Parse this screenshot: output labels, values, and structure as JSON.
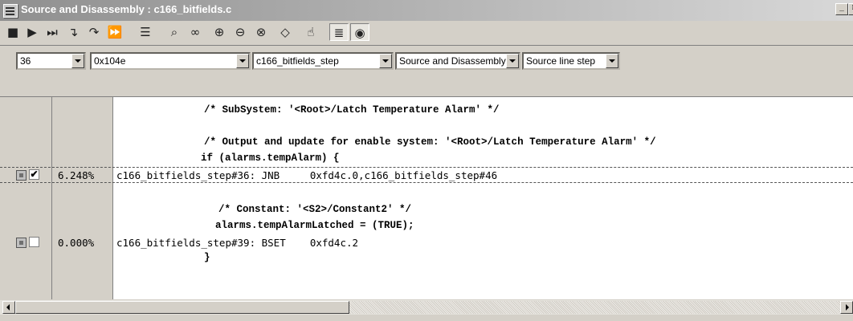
{
  "window": {
    "title": "Source and Disassembly : c166_bitfields.c",
    "min_glyph": "_",
    "max_glyph": "□"
  },
  "toolbar": {
    "tools": [
      {
        "name": "stop-icon",
        "glyph": "■"
      },
      {
        "name": "run-icon",
        "glyph": "▶"
      },
      {
        "name": "skip-to-end-icon",
        "glyph": "⏭"
      },
      {
        "name": "step-into-icon",
        "glyph": "↴"
      },
      {
        "name": "step-over-icon",
        "glyph": "↷"
      },
      {
        "name": "step-out-icon",
        "glyph": "⏩"
      },
      {
        "name": "align-icon",
        "glyph": "☰"
      },
      {
        "name": "find-icon",
        "glyph": "⌕"
      },
      {
        "name": "find-next-icon",
        "glyph": "∞"
      },
      {
        "name": "zoom-in-icon",
        "glyph": "⊕"
      },
      {
        "name": "zoom-out-icon",
        "glyph": "⊖"
      },
      {
        "name": "zoom-fit-icon",
        "glyph": "⊗"
      },
      {
        "name": "diamond-icon",
        "glyph": "◇"
      },
      {
        "name": "hand-icon",
        "glyph": "☝"
      },
      {
        "name": "source-view-icon",
        "glyph": "≣"
      },
      {
        "name": "profile-icon",
        "glyph": "◉"
      }
    ]
  },
  "selectors": {
    "line": "36",
    "address": "0x104e",
    "function": "c166_bitfields_step",
    "view": "Source and Disassembly",
    "step_mode": "Source line step"
  },
  "code": {
    "src1": "/* SubSystem: '<Root>/Latch Temperature Alarm' */",
    "src2": "/* Output and update for enable system: '<Root>/Latch Temperature Alarm' */",
    "src3": "if (alarms.tempAlarm) {",
    "dis1": "c166_bitfields_step#36: JNB     0xfd4c.0,c166_bitfields_step#46",
    "pct1": "6.248%",
    "src4": "/* Constant: '<S2>/Constant2' */",
    "src5": "alarms.tempAlarmLatched = (TRUE);",
    "dis2": "c166_bitfields_step#39: BSET    0xfd4c.2",
    "pct2": "0.000%",
    "src6": "}",
    "check1": "✔",
    "check2": ""
  }
}
